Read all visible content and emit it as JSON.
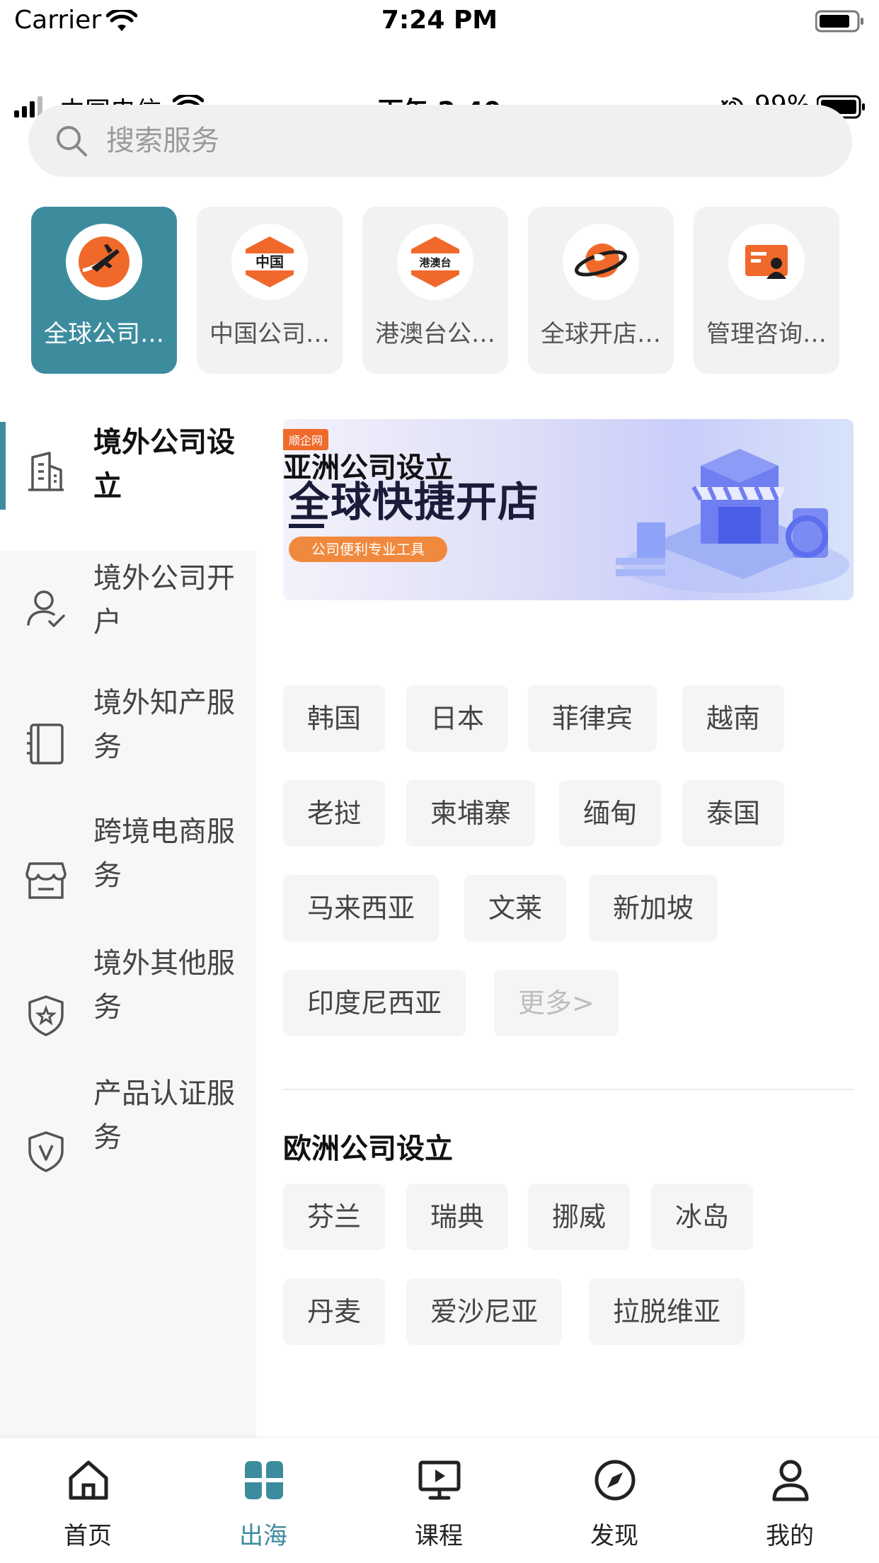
{
  "status_sim": {
    "carrier": "Carrier",
    "time": "7:24 PM"
  },
  "status_phone": {
    "carrier": "中国电信",
    "time": "下午 2:40",
    "battery": "99%"
  },
  "search": {
    "placeholder": "搜索服务"
  },
  "categories": [
    {
      "label": "全球公司…",
      "icon": "globe-plane-icon",
      "active": true
    },
    {
      "label": "中国公司…",
      "icon": "china-hexagon-icon",
      "badge": "中国"
    },
    {
      "label": "港澳台公…",
      "icon": "hk-macau-taiwan-hexagon-icon",
      "badge": "港澳台"
    },
    {
      "label": "全球开店…",
      "icon": "globe-ring-icon"
    },
    {
      "label": "管理咨询…",
      "icon": "consulting-icon"
    }
  ],
  "sidebar": {
    "items": [
      {
        "label": "境外公司设立",
        "icon": "building-icon",
        "active": true
      },
      {
        "label": "境外公司开户",
        "icon": "person-check-icon"
      },
      {
        "label": "境外知产服务",
        "icon": "book-icon"
      },
      {
        "label": "跨境电商服务",
        "icon": "store-icon"
      },
      {
        "label": "境外其他服务",
        "icon": "shield-star-icon"
      },
      {
        "label": "产品认证服务",
        "icon": "shield-v-icon"
      }
    ]
  },
  "banner": {
    "tag": "顺企网",
    "title": "全球快捷开店",
    "subtitle": "公司便利专业工具"
  },
  "sections": [
    {
      "title": "亚洲公司设立",
      "tags": [
        "韩国",
        "日本",
        "菲律宾",
        "越南",
        "老挝",
        "柬埔寨",
        "缅甸",
        "泰国",
        "马来西亚",
        "文莱",
        "新加坡",
        "印度尼西亚"
      ],
      "more": "更多>"
    },
    {
      "title": "欧洲公司设立",
      "tags": [
        "芬兰",
        "瑞典",
        "挪威",
        "冰岛",
        "丹麦",
        "爱沙尼亚",
        "拉脱维亚"
      ]
    }
  ],
  "tabbar": {
    "items": [
      {
        "label": "首页",
        "icon": "home-icon"
      },
      {
        "label": "出海",
        "icon": "four-petal-icon",
        "active": true
      },
      {
        "label": "课程",
        "icon": "monitor-play-icon"
      },
      {
        "label": "发现",
        "icon": "compass-icon"
      },
      {
        "label": "我的",
        "icon": "user-icon"
      }
    ]
  },
  "colors": {
    "accent": "#3d8c9e",
    "orange": "#f06a2b"
  }
}
